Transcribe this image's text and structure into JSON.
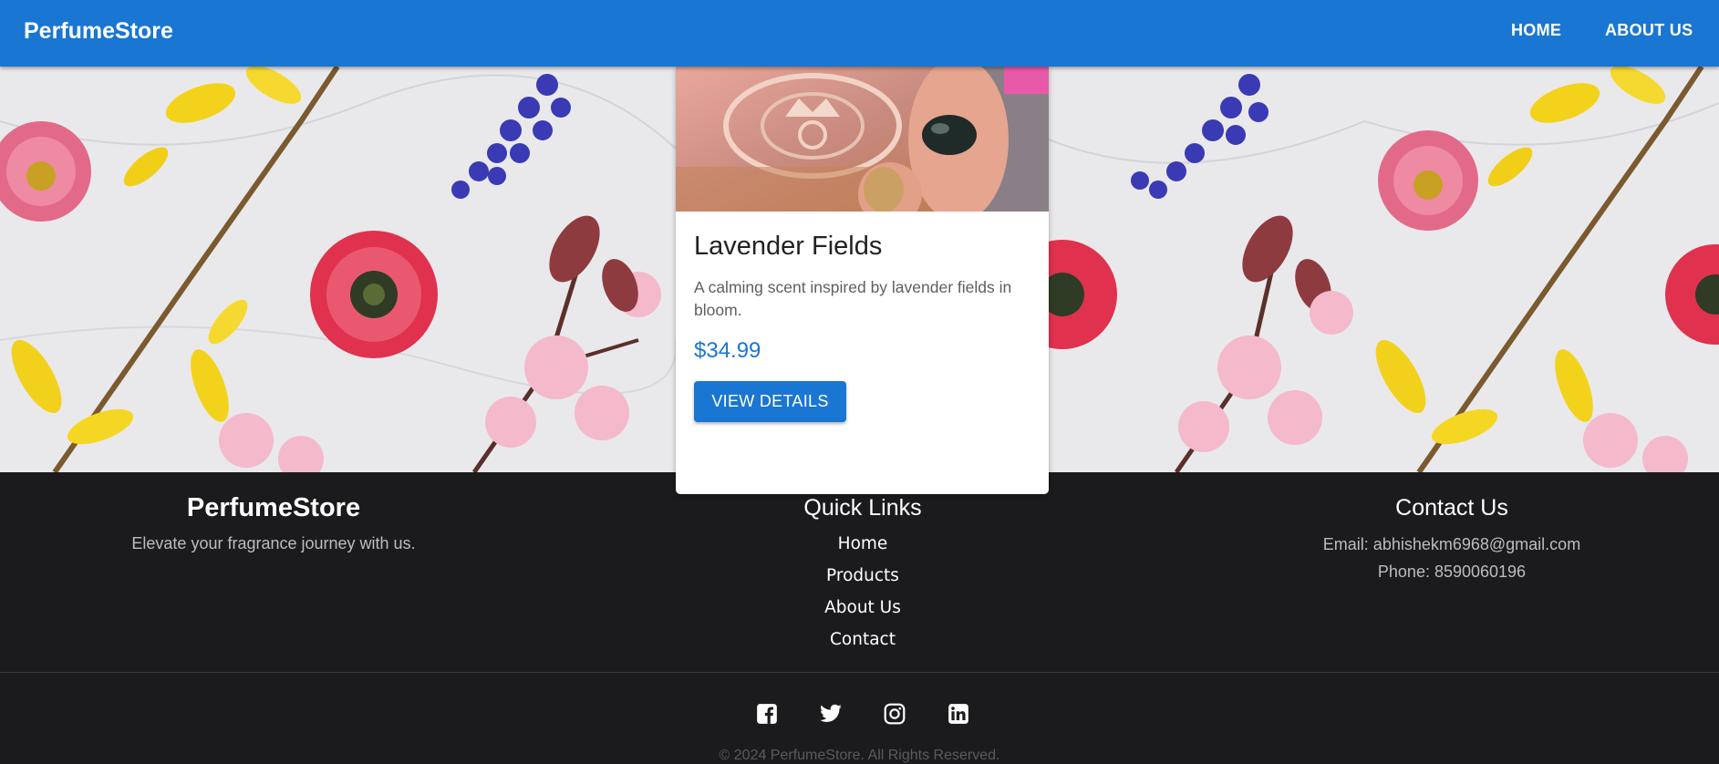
{
  "navbar": {
    "brand": "PerfumeStore",
    "links": [
      "HOME",
      "ABOUT US"
    ]
  },
  "product": {
    "name": "Lavender Fields",
    "description": "A calming scent inspired by lavender fields in bloom.",
    "price": "$34.99",
    "button_label": "VIEW DETAILS"
  },
  "footer": {
    "brand": "PerfumeStore",
    "tagline": "Elevate your fragrance journey with us.",
    "quick_links_heading": "Quick Links",
    "quick_links": [
      "Home",
      "Products",
      "About Us",
      "Contact"
    ],
    "contact_heading": "Contact Us",
    "email": "Email: abhishekm6968@gmail.com",
    "phone": "Phone: 8590060196",
    "social_icons": [
      "facebook-icon",
      "twitter-icon",
      "instagram-icon",
      "linkedin-icon"
    ],
    "copyright": "© 2024 PerfumeStore. All Rights Reserved."
  },
  "colors": {
    "primary": "#1976d2",
    "footer_bg": "#1b1b1d",
    "card_bg": "#ffffff"
  }
}
